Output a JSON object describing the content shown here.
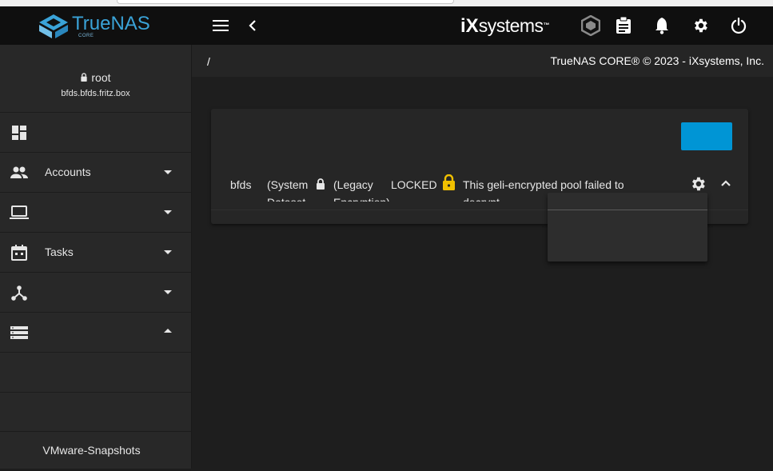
{
  "browser": {},
  "topbar": {
    "logo_text": "TrueNAS",
    "logo_sub": "CORE",
    "vendor_logo": "iX",
    "vendor_logo_rest": "systems",
    "vendor_tm": "™",
    "icons": [
      "menu-icon",
      "back-chevron-icon",
      "truecommand-icon",
      "clipboard-icon",
      "bell-icon",
      "gear-icon",
      "power-icon"
    ]
  },
  "sidebar": {
    "user": "root",
    "host": "bfds.bfds.fritz.box",
    "items": [
      {
        "label": "",
        "icon": "dashboard-icon"
      },
      {
        "label": "Accounts",
        "icon": "people-icon"
      },
      {
        "label": "",
        "icon": "laptop-icon"
      },
      {
        "label": "Tasks",
        "icon": "calendar-icon"
      },
      {
        "label": "",
        "icon": "network-icon"
      },
      {
        "label": "",
        "icon": "storage-icon"
      }
    ],
    "subitems": [
      "",
      "",
      "VMware-Snapshots"
    ]
  },
  "breadcrumb": {
    "path": "/",
    "copyright": "TrueNAS CORE® © 2023 - iXsystems, Inc."
  },
  "pool": {
    "name": "bfds",
    "system_dataset": "(System Dataset",
    "legacy": "(Legacy Encryption)",
    "status": "LOCKED",
    "message": "This geli-encrypted pool failed to decrypt"
  },
  "colors": {
    "accent": "#0095d5",
    "lock": "#f0c000",
    "logo": "#3aa3d8"
  }
}
